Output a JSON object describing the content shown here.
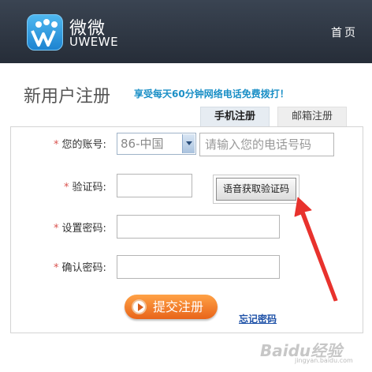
{
  "header": {
    "logo_cn": "微微",
    "logo_en": "UWEWE",
    "home_link": "首页"
  },
  "title": {
    "heading": "新用户注册",
    "promo": "享受每天60分钟网络电话免费拨打！"
  },
  "tabs": [
    {
      "label": "手机注册",
      "active": true
    },
    {
      "label": "邮箱注册",
      "active": false
    }
  ],
  "form": {
    "required_mark": "*",
    "account_label": "您的账号:",
    "country_select_value": "86-中国",
    "phone_placeholder": "请输入您的电话号码",
    "code_label": "验证码:",
    "code_value": "",
    "voice_code_button": "语音获取验证码",
    "password_label": "设置密码:",
    "password_value": "",
    "confirm_label": "确认密码:",
    "confirm_value": "",
    "submit_button": "提交注册",
    "forgot_link": "忘记密码"
  },
  "annotation": {
    "arrow_color": "#e8322d"
  },
  "watermark": {
    "text": "Baidu经验",
    "sub": "jingyan.baidu.com"
  }
}
